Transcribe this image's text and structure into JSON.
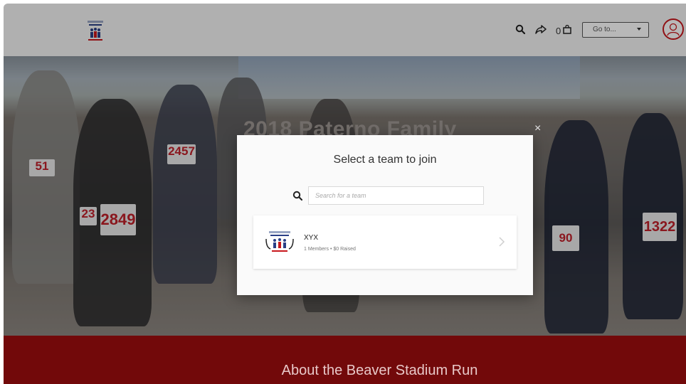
{
  "header": {
    "bag_count": "0",
    "goto_label": "Go to...",
    "icons": [
      "search-icon",
      "share-icon",
      "bag-icon",
      "chevron-down-icon",
      "user-icon"
    ]
  },
  "hero": {
    "title": "2018 Paterno Family",
    "bibs": [
      "51",
      "2457",
      "2849",
      "23",
      "90",
      "1322"
    ]
  },
  "modal": {
    "title": "Select a team to join",
    "search_placeholder": "Search for a team",
    "teams": [
      {
        "name": "XYX",
        "meta": "1 Members • $0 Raised"
      }
    ],
    "close": "×"
  },
  "section": {
    "title": "About the Beaver Stadium Run"
  },
  "colors": {
    "brand_red": "#9e0d0e",
    "avatar_ring": "#c8171c"
  }
}
